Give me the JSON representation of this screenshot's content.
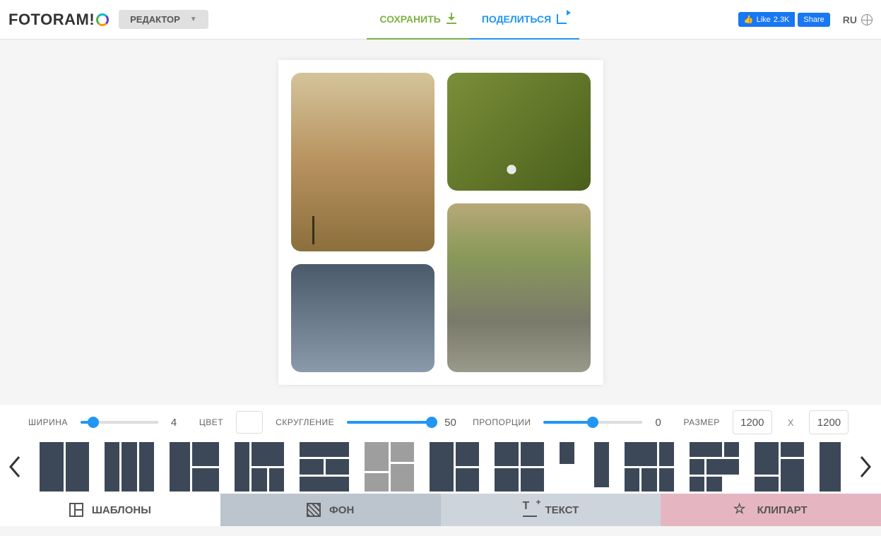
{
  "header": {
    "logo_text": "FOTORAM",
    "editor_label": "РЕДАКТОР",
    "save_label": "СОХРАНИТЬ",
    "share_label": "ПОДЕЛИТЬСЯ",
    "fb_like_label": "Like",
    "fb_like_count": "2.3K",
    "fb_share_label": "Share",
    "lang": "RU"
  },
  "controls": {
    "width_label": "ШИРИНА",
    "width_value": "4",
    "color_label": "ЦВЕТ",
    "color_value": "#ffffff",
    "rounding_label": "СКРУГЛЕНИЕ",
    "rounding_value": "50",
    "proportions_label": "ПРОПОРЦИИ",
    "proportions_value": "0",
    "size_label": "РАЗМЕР",
    "size_w": "1200",
    "size_x": "X",
    "size_h": "1200"
  },
  "bottom_tabs": {
    "templates": "ШАБЛОНЫ",
    "bg": "ФОН",
    "text": "ТЕКСТ",
    "clipart": "КЛИПАРТ"
  },
  "templates_active_index": 5
}
